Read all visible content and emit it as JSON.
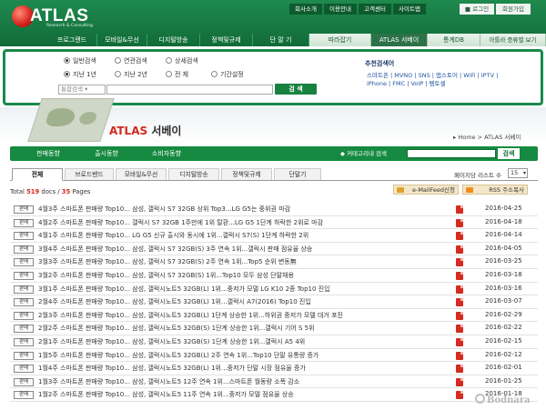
{
  "header": {
    "logo": "ATLAS",
    "logo_sub": "Research & Consulting",
    "util_links": [
      "회사소개",
      "이용안내",
      "고객센터",
      "사이트맵"
    ],
    "login": "로그인",
    "join": "회원가입",
    "nav": [
      "프로그랜드",
      "모바일&무선",
      "디지털방송",
      "정책및규제",
      "단 말 기",
      "따라잡기",
      "ATLAS 서베이",
      "통계DB",
      "아틀라 중류별 보기"
    ],
    "nav_selected": "ATLAS 서베이"
  },
  "search_panel": {
    "scope_options": [
      "일반검색",
      "연관검색",
      "상세검색"
    ],
    "scope_selected": "일반검색",
    "period_options": [
      "지난 1년",
      "지난 2년",
      "전    체",
      "기간설정"
    ],
    "period_selected": "지난 1년",
    "input_label": "통합검색 ▾",
    "search_button": "검   색",
    "recommend_title": "추천검색어",
    "recommend_lines": [
      "스마트폰 | MVNO | SNS | 앱스토어 | WiFi | IPTV |",
      "iPhone | FMC | VoIP | 펨토셀"
    ]
  },
  "page": {
    "title_en": "ATLAS",
    "title_ko": "서베이",
    "breadcrumb": "▸ Home  >  ATLAS 서베이"
  },
  "sub_nav": {
    "tabs": [
      "판매동향",
      "출시동향",
      "소비자동향"
    ],
    "search_label": "◆ 커테고리내 검색",
    "search_button": "검색"
  },
  "category_tabs": {
    "tabs": [
      "전체",
      "브로드밴드",
      "모바일&무선",
      "디지털방송",
      "정책및규제",
      "단말기"
    ],
    "selected": "전체",
    "page_size_label": "페이지당 리스트 수",
    "page_size": "15"
  },
  "summary": {
    "prefix": "Total",
    "docs": "519",
    "docs_unit": "docs /",
    "pages": "35",
    "pages_unit": "Pages",
    "email_btn": "e-MailFeed신청",
    "rss_btn": "RSS 주소복사"
  },
  "list": {
    "badge": "판매",
    "rows": [
      {
        "title": "4월3주 스마트폰 판매량 Top10... 삼성, 갤럭시 S7 32GB 상위 Top3...LG G5는 중위권 마감",
        "date": "2016-04-25"
      },
      {
        "title": "4월2주 스마트폰 판매량 Top10... 갤럭시 S7 32GB 1주만에 1위 탈환...LG G5 1단계 하락한 2위로 마감",
        "date": "2016-04-18"
      },
      {
        "title": "4월1주 스마트폰 판매량 Top10... LG G5 신규 출시와 동시에 1위...갤럭시 S7(S) 1단계 하락한 2위",
        "date": "2016-04-14"
      },
      {
        "title": "3월4주 스마트폰 판매량 Top10... 삼성, 갤럭시 S7 32GB(S) 3주 연속 1위...갤럭시 판매 점유율 상승",
        "date": "2016-04-05"
      },
      {
        "title": "3월3주 스마트폰 판매량 Top10... 삼성, 갤럭시 S7 32GB(S) 2주 연속 1위...Top5 순위 변동無",
        "date": "2016-03-25"
      },
      {
        "title": "3월2주 스마트폰 판매량 Top10... 삼성, 갤럭시 S7 32GB(S) 1위...Top10 모두 삼성 단말채용",
        "date": "2016-03-18"
      },
      {
        "title": "3월1주 스마트폰 판매량 Top10... 삼성, 갤럭시노트5 32GB(L) 1위...중저가 모델 LG K10 2종 Top10 진입",
        "date": "2016-03-16"
      },
      {
        "title": "2월4주 스마트폰 판매량 Top10... 삼성, 갤럭시노트5 32GB(L) 1위...갤럭시 A7(2016) Top10 진입",
        "date": "2016-03-07"
      },
      {
        "title": "2월3주 스마트폰 판매량 Top10... 삼성, 갤럭시노트5 32GB(L) 1단계 상승한 1위...하위권 중저가 모델 대거 포진",
        "date": "2016-02-29"
      },
      {
        "title": "2월2주 스마트폰 판매량 Top10... 삼성, 갤럭시노트5 32GB(S) 1단계 상승한 1위...갤럭시 기어 S 5위",
        "date": "2016-02-22"
      },
      {
        "title": "2월1주 스마트폰 판매량 Top10... 삼성, 갤럭시노트5 32GB(S) 1단계 상승한 1위...갤럭시 A5 4위",
        "date": "2016-02-15"
      },
      {
        "title": "1월5주 스마트폰 판매량 Top10... 삼성, 갤럭시노트5 32GB(L) 2주 연속 1위...Top10 단말 유통량 증가",
        "date": "2016-02-12"
      },
      {
        "title": "1월4주 스마트폰 판매량 Top10... 삼성, 갤럭시노트5 32GB(L) 1위...중저가 단말 시장 점유율 증가",
        "date": "2016-02-01"
      },
      {
        "title": "1월3주 스마트폰 판매량 Top10... 삼성, 갤럭시노트5 12주 연속 1위...스마트폰 월동량 소폭 감소",
        "date": "2016-01-25"
      },
      {
        "title": "1월2주 스마트폰 판매량 Top10... 삼성, 갤럭시노트5 11주 연속 1위...중저가 모델 점유율 상승",
        "date": "2016-01-18"
      }
    ]
  },
  "watermark": "Bodnara"
}
